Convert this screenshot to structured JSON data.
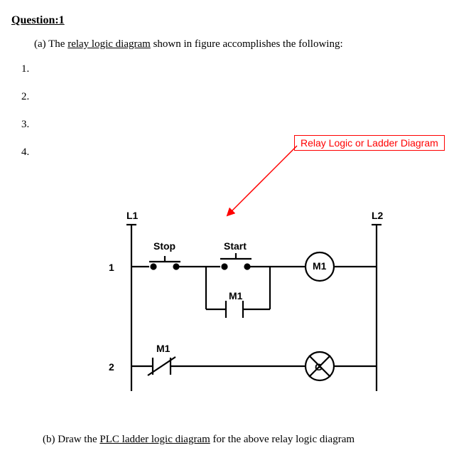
{
  "heading": "Question:1",
  "partA": {
    "prefix": "(a) The ",
    "underlined": "relay logic diagram",
    "suffix": " shown in figure accomplishes the following:"
  },
  "listItems": [
    "1.",
    "2.",
    "3.",
    "4."
  ],
  "annotation": "Relay Logic or Ladder Diagram",
  "diagram": {
    "leftRail": "L1",
    "rightRail": "L2",
    "stopLabel": "Stop",
    "startLabel": "Start",
    "rung1Num": "1",
    "rung2Num": "2",
    "coil1": "M1",
    "sealContact": "M1",
    "ncContact": "M1",
    "indicator": "G"
  },
  "partB": {
    "prefix": "(b) Draw the ",
    "underlined": "PLC ladder logic diagram",
    "suffix": " for the above relay logic diagram"
  }
}
